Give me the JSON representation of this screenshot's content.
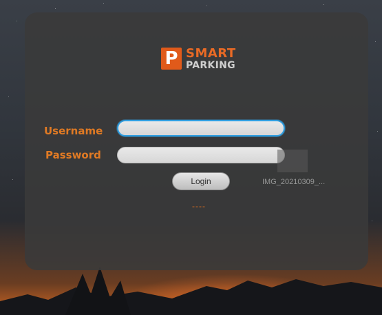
{
  "logo": {
    "badge_letter": "P",
    "line1": "SMART",
    "line2": "PARKING"
  },
  "form": {
    "username_label": "Username",
    "password_label": "Password",
    "username_value": "",
    "password_value": "",
    "login_label": "Login",
    "status_text": "----"
  },
  "desktop_item": {
    "label": "IMG_20210309_..."
  },
  "colors": {
    "accent": "#e07a24",
    "panel": "#3a3a3a",
    "focus": "#2f9ee0"
  }
}
